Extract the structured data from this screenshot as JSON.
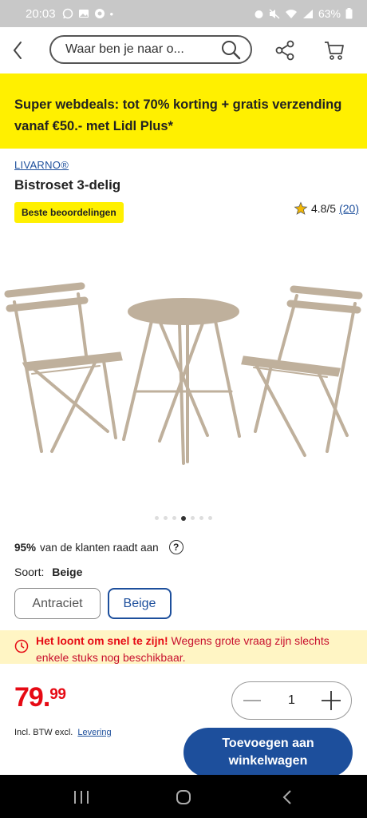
{
  "status_bar": {
    "time": "20:03",
    "battery": "63%"
  },
  "header": {
    "search_placeholder": "Waar ben je naar o..."
  },
  "promo": {
    "text": "Super webdeals: tot 70% korting + gratis verzending vanaf €50.- met Lidl Plus*"
  },
  "product": {
    "brand": "LIVARNO®",
    "title": "Bistroset 3-delig",
    "badge": "Beste beoordelingen",
    "rating": "4.8/5",
    "rating_count": "(20)",
    "image_count": 7,
    "active_image": 4,
    "product_color": "#bfb09c"
  },
  "recommend": {
    "percent": "95%",
    "text": "van de klanten raadt aan",
    "help": "?"
  },
  "variant": {
    "label": "Soort:",
    "selected": "Beige",
    "options": [
      "Antraciet",
      "Beige"
    ]
  },
  "notice": {
    "strong": "Het loont om snel te zijn!",
    "text": " Wegens grote vraag zijn slechts enkele stuks nog beschikbaar."
  },
  "price": {
    "main": "79.",
    "cents": "99"
  },
  "quantity": {
    "value": "1"
  },
  "vat": {
    "text": "Incl. BTW excl.",
    "link": "Levering"
  },
  "add_button": {
    "label": "Toevoegen aan winkelwagen"
  },
  "colors": {
    "accent_blue": "#1d4f9c",
    "promo_yellow": "#fff000",
    "price_red": "#e60a14"
  }
}
